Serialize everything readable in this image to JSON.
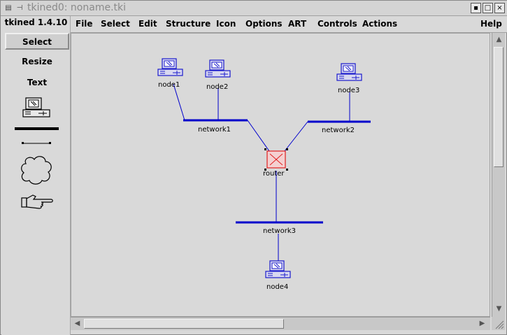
{
  "window": {
    "title": "tkined0: noname.tki",
    "controls": {
      "iconify": "▪",
      "maximize": "□",
      "close": "×"
    }
  },
  "palette": {
    "version": "tkined 1.4.10",
    "tools": [
      {
        "label": "Select",
        "active": true
      },
      {
        "label": "Resize",
        "active": false
      },
      {
        "label": "Text",
        "active": false
      }
    ],
    "tool_icons": [
      "node-icon",
      "network-icon",
      "link-icon",
      "cloud-icon",
      "pointing-hand-icon"
    ]
  },
  "menubar": {
    "items": [
      "File",
      "Select",
      "Edit",
      "Structure",
      "Icon",
      "Options",
      "ART",
      "Controls",
      "Actions"
    ],
    "help": "Help"
  },
  "canvas": {
    "colors": {
      "network": "#0000cc",
      "link": "#0000cc",
      "node": "#1a1acc",
      "router": "#e02020"
    },
    "nodes": [
      {
        "label": "node1"
      },
      {
        "label": "node2"
      },
      {
        "label": "node3"
      },
      {
        "label": "node4"
      }
    ],
    "networks": [
      {
        "label": "network1"
      },
      {
        "label": "network2"
      },
      {
        "label": "network3"
      }
    ],
    "router": {
      "label": "router",
      "selected": true
    }
  }
}
